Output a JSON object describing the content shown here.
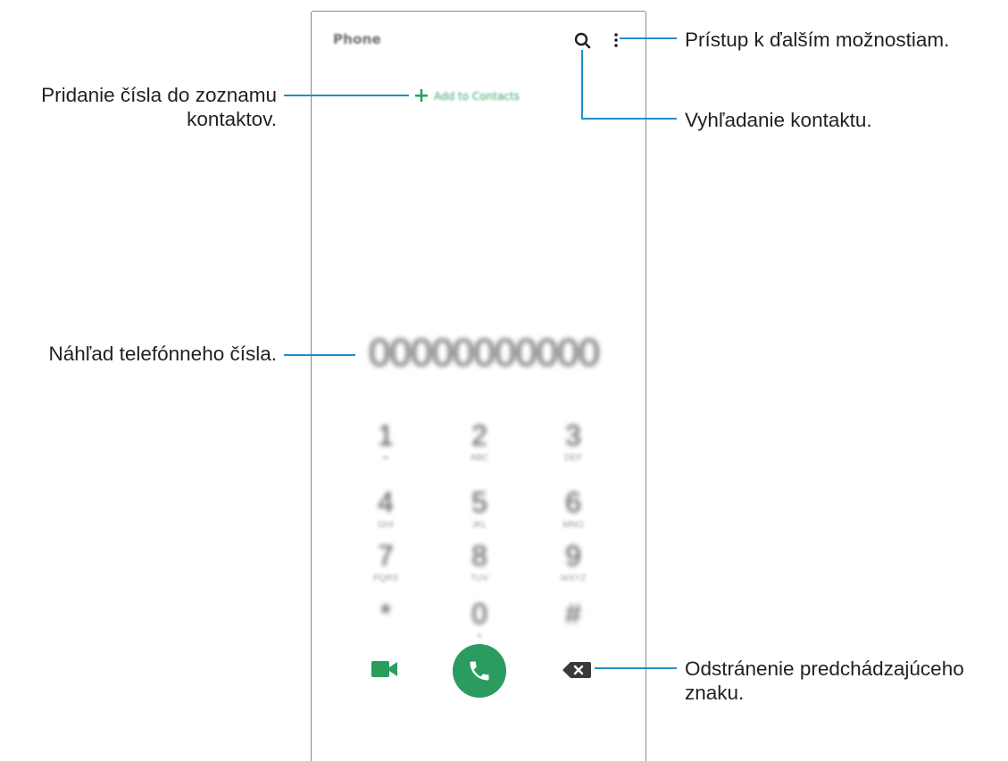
{
  "app": {
    "title": "Phone"
  },
  "toolbar": {
    "search_icon": "search-icon",
    "more_icon": "more-vert-icon"
  },
  "add_contacts": {
    "label": "Add to Contacts",
    "icon": "plus-icon"
  },
  "dialer": {
    "number": "00000000000",
    "keys": [
      {
        "digit": "1",
        "letters": "∞"
      },
      {
        "digit": "2",
        "letters": "ABC"
      },
      {
        "digit": "3",
        "letters": "DEF"
      },
      {
        "digit": "4",
        "letters": "GHI"
      },
      {
        "digit": "5",
        "letters": "JKL"
      },
      {
        "digit": "6",
        "letters": "MNO"
      },
      {
        "digit": "7",
        "letters": "PQRS"
      },
      {
        "digit": "8",
        "letters": "TUV"
      },
      {
        "digit": "9",
        "letters": "WXYZ"
      },
      {
        "digit": "*",
        "letters": ""
      },
      {
        "digit": "0",
        "letters": "+"
      },
      {
        "digit": "#",
        "letters": ""
      }
    ]
  },
  "actions": {
    "video_icon": "video-call-icon",
    "call_icon": "phone-icon",
    "backspace_icon": "backspace-icon"
  },
  "colors": {
    "accent": "#2a9d5e",
    "callout_line": "#1f8fc7"
  },
  "callouts": {
    "more_options": "Prístup k ďalším možnostiam.",
    "search": "Vyhľadanie kontaktu.",
    "add_contacts_1": "Pridanie čísla do zoznamu",
    "add_contacts_2": "kontaktov.",
    "number_preview": "Náhľad telefónneho čísla.",
    "delete_1": "Odstránenie predchádzajúceho",
    "delete_2": "znaku."
  }
}
